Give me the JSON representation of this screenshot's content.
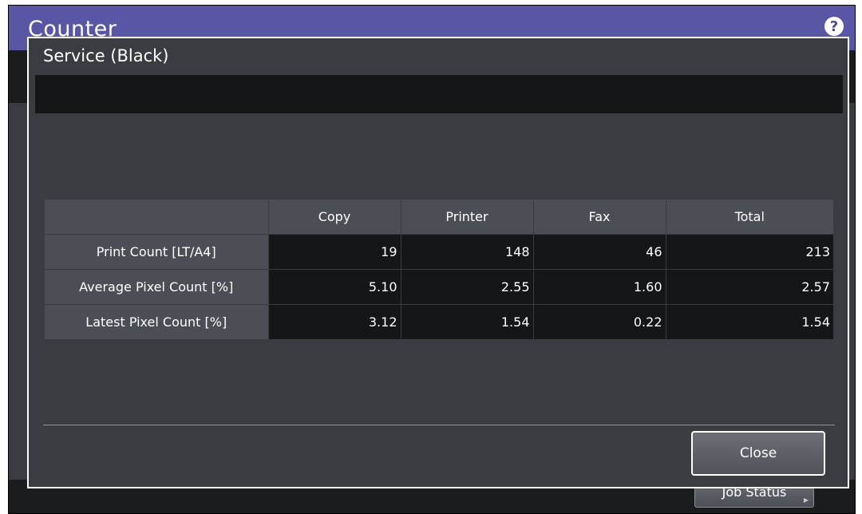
{
  "app": {
    "title": "Counter",
    "help_icon_glyph": "?",
    "job_status_label": "Job Status"
  },
  "dialog": {
    "title": "Service (Black)",
    "close_label": "Close"
  },
  "table": {
    "columns": [
      "",
      "Copy",
      "Printer",
      "Fax",
      "Total"
    ],
    "rows": [
      {
        "label": "Print Count [LT/A4]",
        "values": [
          "19",
          "148",
          "46",
          "213"
        ]
      },
      {
        "label": "Average Pixel Count [%]",
        "values": [
          "5.10",
          "2.55",
          "1.60",
          "2.57"
        ]
      },
      {
        "label": "Latest Pixel Count [%]",
        "values": [
          "3.12",
          "1.54",
          "0.22",
          "1.54"
        ]
      }
    ]
  },
  "colors": {
    "title_bar": "#5a56a6",
    "panel": "#3a3c42",
    "dark_cell": "#151617",
    "header_cell": "#4b4e55"
  }
}
